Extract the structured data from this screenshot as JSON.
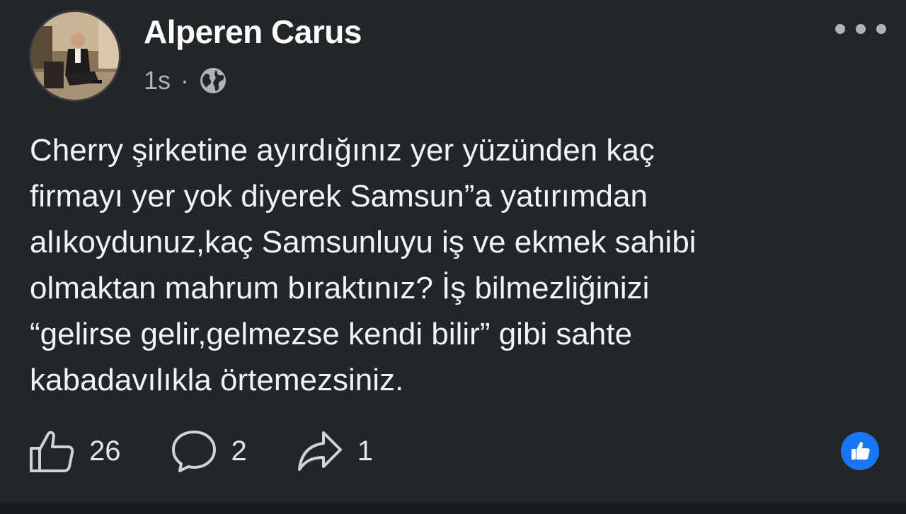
{
  "post": {
    "author": {
      "name": "Alperen Carus",
      "avatar_icon": "profile-photo"
    },
    "meta": {
      "time": "1s",
      "separator": "·",
      "audience_icon": "globe-icon"
    },
    "menu_icon": "more-dots-icon",
    "text_lines": [
      "Cherry şirketine ayırdığınız yer yüzünden kaç",
      "firmayı yer yok diyerek Samsun”a yatırımdan",
      "alıkoydunuz,kaç Samsunluyu iş ve ekmek sahibi",
      "olmaktan mahrum bıraktınız? İş bilmezliğinizi",
      "“gelirse gelir,gelmezse kendi bilir” gibi sahte",
      "kabadavılıkla örtemezsiniz."
    ],
    "actions": {
      "like": {
        "icon": "thumbs-up-icon",
        "count": "26"
      },
      "comment": {
        "icon": "comment-icon",
        "count": "2"
      },
      "share": {
        "icon": "share-icon",
        "count": "1"
      }
    },
    "reaction_badge": {
      "icon": "like-reaction-icon",
      "color": "#1877f2"
    }
  },
  "theme": {
    "background": "#242526",
    "text": "#e4e6eb",
    "secondary_text": "#b0b3b8"
  }
}
